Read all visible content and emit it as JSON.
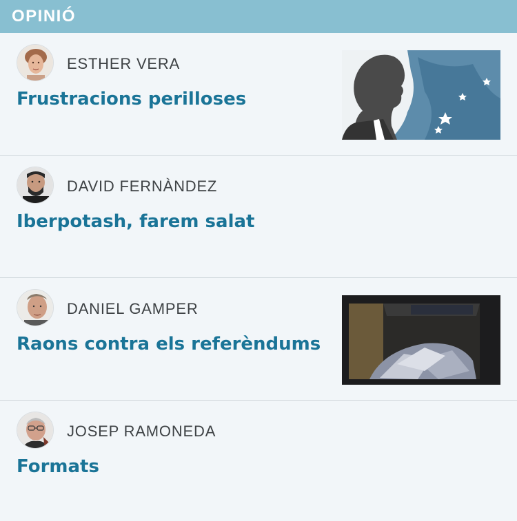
{
  "section": {
    "title": "OPINIÓ"
  },
  "articles": [
    {
      "author": "ESTHER VERA",
      "headline": "Frustracions perilloses",
      "has_image": true
    },
    {
      "author": "DAVID FERNÀNDEZ",
      "headline": "Iberpotash, farem salat",
      "has_image": false
    },
    {
      "author": "DANIEL GAMPER",
      "headline": "Raons contra els referèndums",
      "has_image": true
    },
    {
      "author": "JOSEP RAMONEDA",
      "headline": "Formats",
      "has_image": false
    }
  ],
  "colors": {
    "header_bg": "#88bfd1",
    "page_bg": "#f2f6f9",
    "headline": "#1a7497",
    "author": "#3e4245",
    "divider": "#cfd6db"
  }
}
